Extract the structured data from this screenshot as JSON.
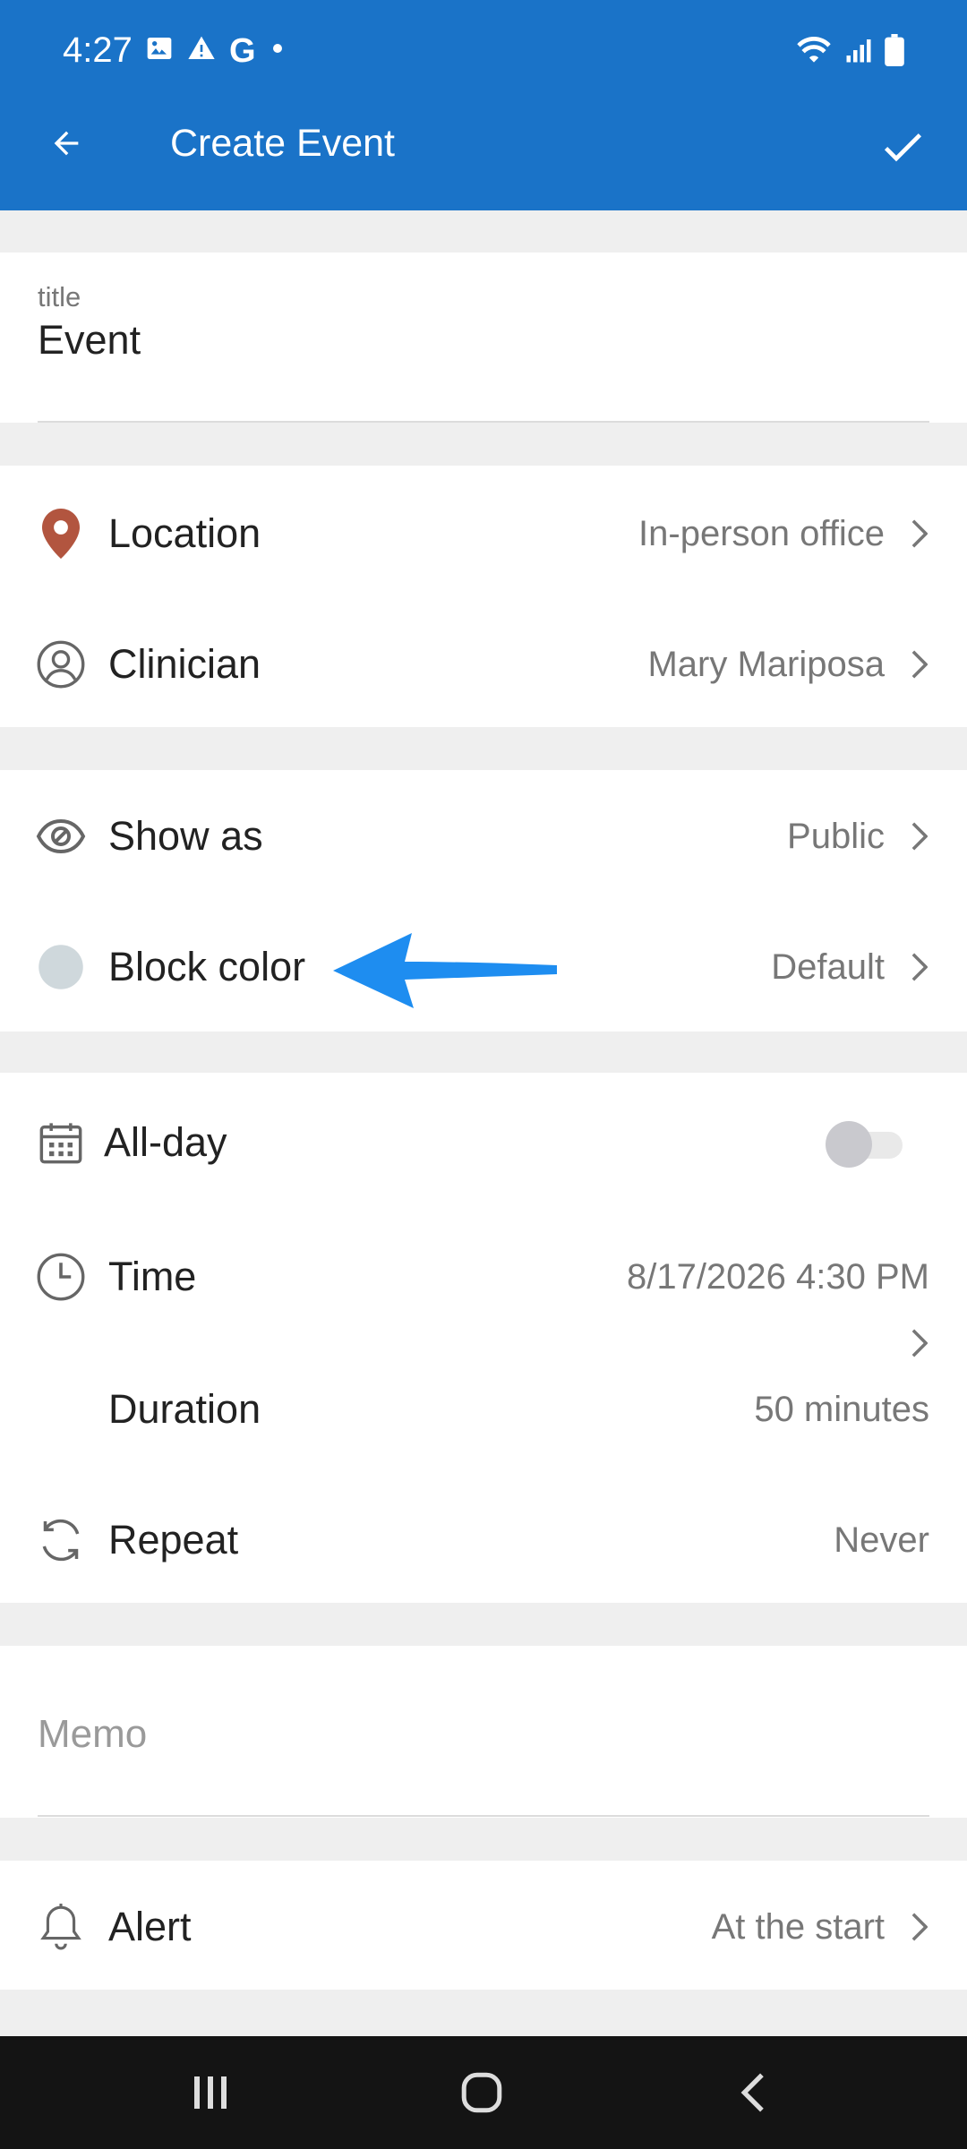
{
  "status_bar": {
    "time": "4:27"
  },
  "app_bar": {
    "title": "Create Event"
  },
  "title_field": {
    "label": "title",
    "value": "Event"
  },
  "rows": {
    "location": {
      "label": "Location",
      "value": "In-person office",
      "icon": "location-pin-icon"
    },
    "clinician": {
      "label": "Clinician",
      "value": "Mary Mariposa",
      "icon": "person-icon"
    },
    "show_as": {
      "label": "Show as",
      "value": "Public",
      "icon": "eye-icon"
    },
    "block_color": {
      "label": "Block color",
      "value": "Default",
      "icon": "color-dot-icon",
      "swatch": "#cfd8dc"
    },
    "all_day": {
      "label": "All-day",
      "icon": "calendar-icon",
      "toggle": "off"
    },
    "time": {
      "label": "Time",
      "value": "8/17/2026 4:30 PM",
      "icon": "clock-icon"
    },
    "duration": {
      "label": "Duration",
      "value": "50 minutes"
    },
    "repeat": {
      "label": "Repeat",
      "value": "Never",
      "icon": "repeat-icon"
    },
    "alert": {
      "label": "Alert",
      "value": "At the start",
      "icon": "bell-icon"
    }
  },
  "memo": {
    "placeholder": "Memo"
  },
  "colors": {
    "header": "#1a73c8",
    "location_pin": "#b2553f",
    "annotation_arrow": "#1e8df0"
  }
}
